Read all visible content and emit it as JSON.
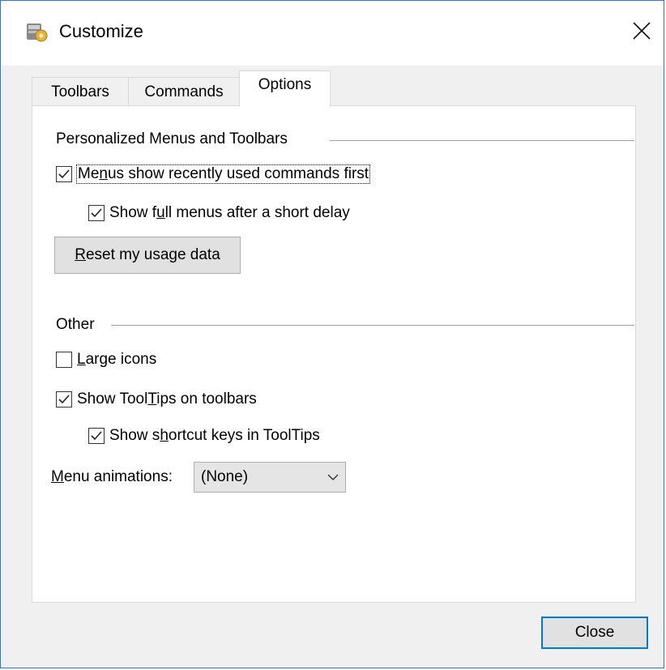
{
  "window": {
    "title": "Customize",
    "icon": "customize-app-icon",
    "close_icon": "close-icon"
  },
  "tabs": [
    {
      "label": "Toolbars",
      "active": false
    },
    {
      "label": "Commands",
      "active": false
    },
    {
      "label": "Options",
      "active": true
    }
  ],
  "personalized": {
    "heading": "Personalized Menus and Toolbars",
    "recent_first": {
      "before": "Me",
      "mnemonic": "n",
      "after": "us show recently used commands first",
      "checked": true
    },
    "full_menus": {
      "before": "Show f",
      "mnemonic": "u",
      "after": "ll menus after a short delay",
      "checked": true
    },
    "reset_button": {
      "mnemonic": "R",
      "after": "eset my usage data"
    }
  },
  "other": {
    "heading": "Other",
    "large_icons": {
      "mnemonic": "L",
      "after": "arge icons",
      "checked": false
    },
    "show_tooltips": {
      "before": "Show Tool",
      "mnemonic": "T",
      "after": "ips on toolbars",
      "checked": true
    },
    "shortcut_keys": {
      "before": "Show s",
      "mnemonic": "h",
      "after": "ortcut keys in ToolTips",
      "checked": true
    },
    "menu_animations": {
      "mnemonic": "M",
      "after": "enu animations:",
      "selected": "(None)"
    }
  },
  "footer": {
    "close_label": "Close"
  },
  "colors": {
    "accent": "#0078d7",
    "window_border": "#2b78d4",
    "dialog_bg": "#f0f0f0"
  }
}
